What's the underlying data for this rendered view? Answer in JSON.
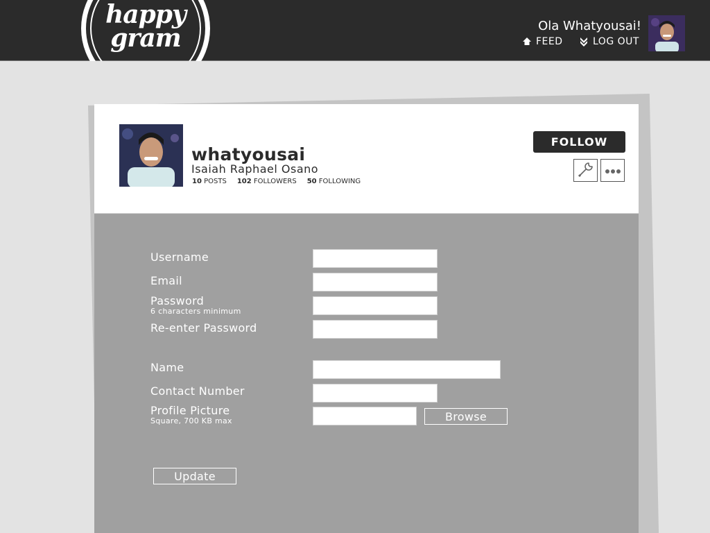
{
  "header": {
    "logo_line1": "happy",
    "logo_line2": "gram",
    "greeting": "Ola Whatyousai!",
    "nav": {
      "feed": "FEED",
      "logout": "LOG OUT"
    }
  },
  "profile": {
    "username": "whatyousai",
    "full_name": "Isaiah Raphael Osano",
    "stats": [
      {
        "count": "10",
        "label": "POSTS"
      },
      {
        "count": "102",
        "label": "FOLLOWERS"
      },
      {
        "count": "50",
        "label": "FOLLOWING"
      }
    ],
    "follow_label": "FOLLOW"
  },
  "form": {
    "username_label": "Username",
    "email_label": "Email",
    "password_label": "Password",
    "password_hint": "6 characters minimum",
    "reenter_password_label": "Re-enter Password",
    "name_label": "Name",
    "contact_label": "Contact Number",
    "picture_label": "Profile Picture",
    "picture_hint": "Square, 700 KB max",
    "browse_label": "Browse",
    "update_label": "Update",
    "values": {
      "username": "",
      "email": "",
      "password": "",
      "reenter_password": "",
      "name": "",
      "contact": "",
      "picture": ""
    }
  },
  "icons": {
    "feed": "home-icon",
    "logout": "chevron-down-double-icon",
    "settings": "wrench-icon",
    "more": "more-dots-icon"
  },
  "colors": {
    "topbar": "#2b2b2b",
    "page_bg": "#e3e3e3",
    "form_bg": "#a0a0a0",
    "follow_button": "#2b2b2b"
  }
}
